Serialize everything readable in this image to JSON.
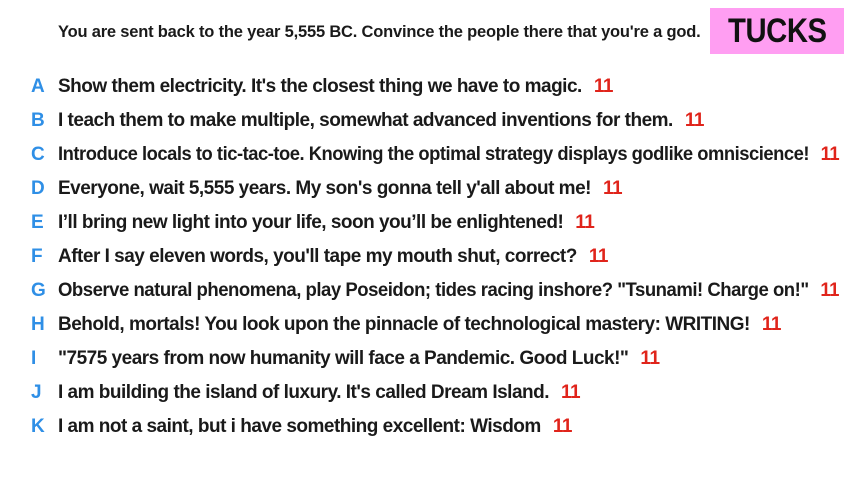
{
  "prompt": "You are sent back to the year 5,555 BC. Convince the people there that you're a god.",
  "badge": "TUCKS",
  "colors": {
    "letter": "#2f8fe6",
    "score": "#e0241b",
    "badge_bg": "#ff9ef2",
    "text": "#1a1a1a"
  },
  "entries": [
    {
      "letter": "A",
      "text": "Show them electricity. It's the closest thing we have to magic.",
      "score": "11"
    },
    {
      "letter": "B",
      "text": "I teach them to make multiple, somewhat advanced inventions for them.",
      "score": "11"
    },
    {
      "letter": "C",
      "text": "Introduce locals to tic-tac-toe. Knowing the optimal strategy displays godlike omniscience!",
      "score": "11"
    },
    {
      "letter": "D",
      "text": "Everyone, wait 5,555 years. My son's gonna tell y'all about me!",
      "score": "11"
    },
    {
      "letter": "E",
      "text": "I’ll bring new light into your life, soon you’ll be enlightened!",
      "score": "11"
    },
    {
      "letter": "F",
      "text": "After I say eleven words, you'll tape my mouth shut, correct?",
      "score": "11"
    },
    {
      "letter": "G",
      "text": "Observe natural phenomena, play Poseidon; tides racing inshore? \"Tsunami! Charge on!\"",
      "score": "11"
    },
    {
      "letter": "H",
      "text": "Behold, mortals! You look upon the pinnacle of technological mastery: WRITING!",
      "score": "11"
    },
    {
      "letter": "I",
      "text": "\"7575 years from now humanity will face a Pandemic. Good Luck!\"",
      "score": "11"
    },
    {
      "letter": "J",
      "text": "I am building the island of luxury. It's called Dream Island.",
      "score": "11"
    },
    {
      "letter": "K",
      "text": "I am not a saint, but i have something excellent: Wisdom",
      "score": "11"
    }
  ]
}
